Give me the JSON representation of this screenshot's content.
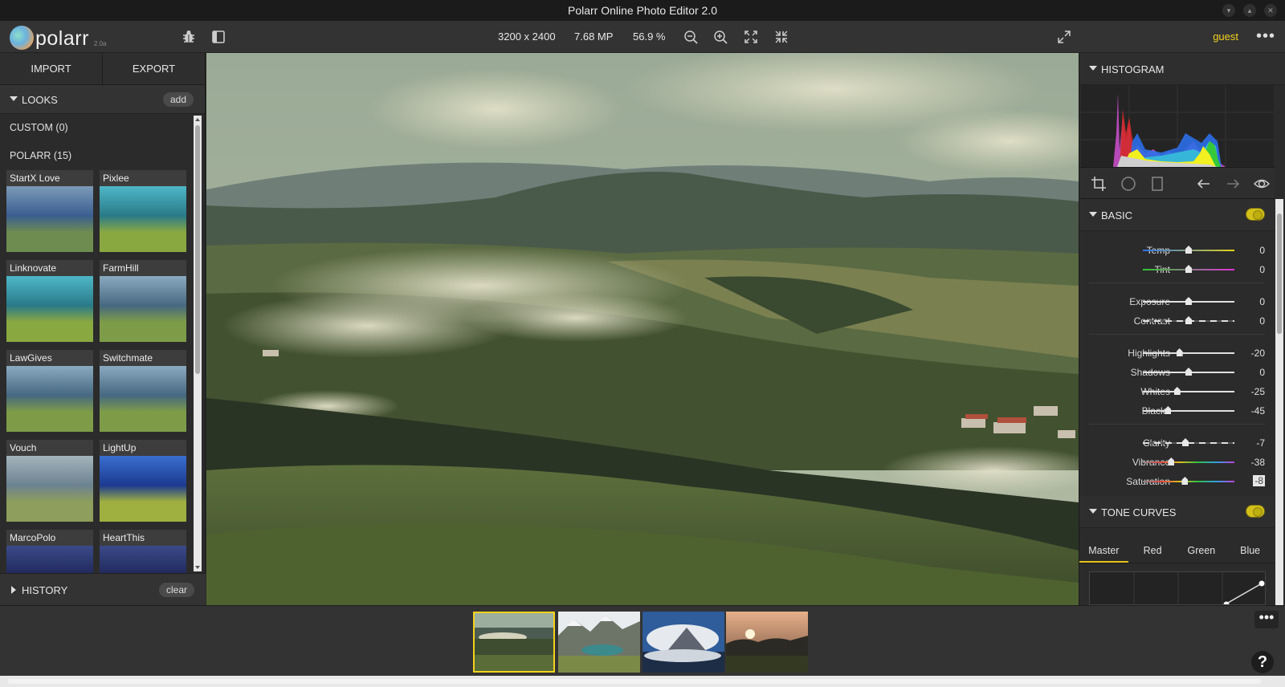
{
  "window": {
    "title": "Polarr Online Photo Editor 2.0"
  },
  "toolbar": {
    "app_name": "polarr",
    "version": "2.0a",
    "dimensions": "3200 x 2400",
    "megapixels": "7.68 MP",
    "zoom": "56.9 %",
    "user": "guest"
  },
  "left_panel": {
    "import_label": "IMPORT",
    "export_label": "EXPORT",
    "looks_label": "LOOKS",
    "add_label": "add",
    "custom_label": "CUSTOM (0)",
    "polarr_label": "POLARR (15)",
    "looks": [
      {
        "name": "StartX Love",
        "tint": "cool"
      },
      {
        "name": "Pixlee",
        "tint": "teal"
      },
      {
        "name": "Linknovate",
        "tint": "teal"
      },
      {
        "name": "FarmHill",
        "tint": "neutral"
      },
      {
        "name": "LawGives",
        "tint": "neutral"
      },
      {
        "name": "Switchmate",
        "tint": "neutral"
      },
      {
        "name": "Vouch",
        "tint": "faded"
      },
      {
        "name": "LightUp",
        "tint": "blue"
      },
      {
        "name": "MarcoPolo",
        "tint": "dark"
      },
      {
        "name": "HeartThis",
        "tint": "dark"
      }
    ],
    "history_label": "HISTORY",
    "clear_label": "clear"
  },
  "right_panel": {
    "histogram_label": "HISTOGRAM",
    "basic_label": "BASIC",
    "basic_enabled": true,
    "sliders": [
      {
        "name": "Temp",
        "value": "0",
        "pos": 0.5,
        "track": "temp"
      },
      {
        "name": "Tint",
        "value": "0",
        "pos": 0.5,
        "track": "tint"
      },
      {
        "name": "Exposure",
        "value": "0",
        "pos": 0.5,
        "track": "plain"
      },
      {
        "name": "Contrast",
        "value": "0",
        "pos": 0.5,
        "track": "dashed"
      },
      {
        "name": "Highlights",
        "value": "-20",
        "pos": 0.4,
        "track": "plain"
      },
      {
        "name": "Shadows",
        "value": "0",
        "pos": 0.5,
        "track": "plain"
      },
      {
        "name": "Whites",
        "value": "-25",
        "pos": 0.375,
        "track": "plain"
      },
      {
        "name": "Blacks",
        "value": "-45",
        "pos": 0.275,
        "track": "plain"
      },
      {
        "name": "Clarity",
        "value": "-7",
        "pos": 0.465,
        "track": "dashed"
      },
      {
        "name": "Vibrance",
        "value": "-38",
        "pos": 0.31,
        "track": "rainbow"
      },
      {
        "name": "Saturation",
        "value": "-8",
        "pos": 0.46,
        "track": "rainbow"
      }
    ],
    "tone_curves_label": "TONE CURVES",
    "tone_curves_enabled": true,
    "curve_tabs": [
      "Master",
      "Red",
      "Green",
      "Blue"
    ],
    "active_curve_tab": "Master"
  },
  "filmstrip": {
    "selected_index": 0,
    "images": [
      "foggy-valley",
      "mountain-lake",
      "cloudy-peak",
      "sunset-forest"
    ],
    "more_label": "•••",
    "help_label": "?"
  },
  "colors": {
    "accent": "#f2d21c"
  }
}
